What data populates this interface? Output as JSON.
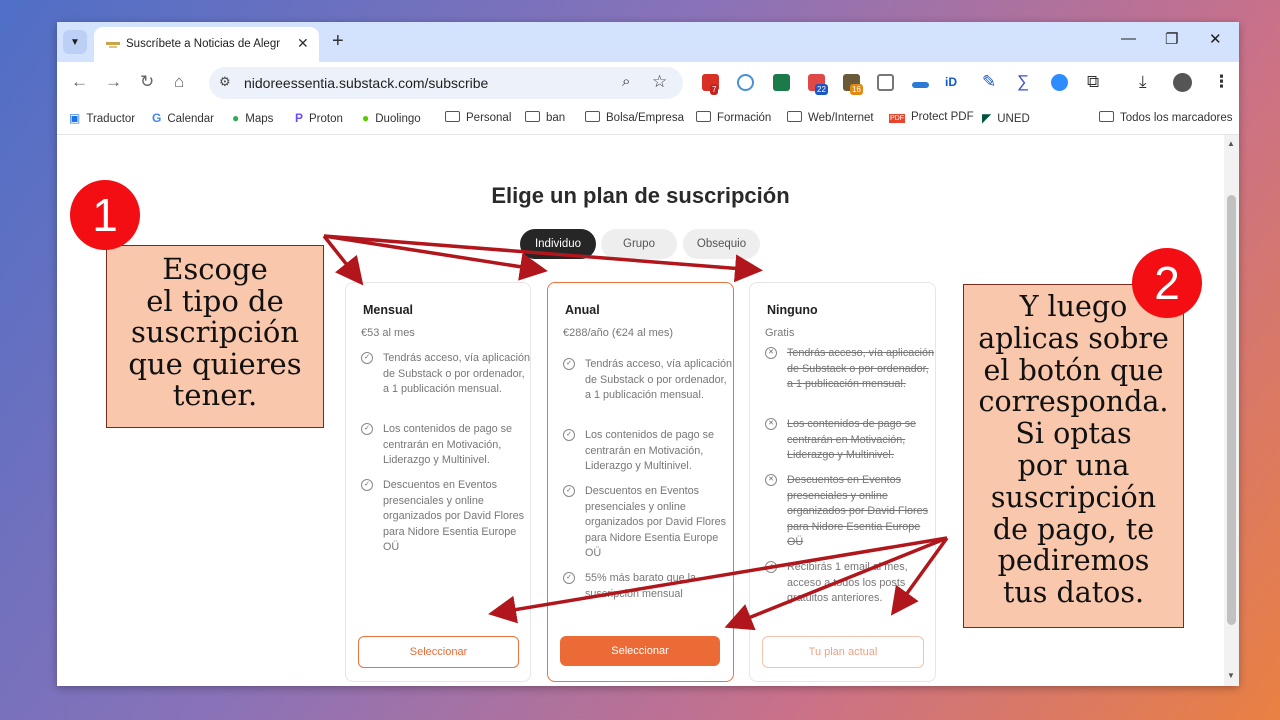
{
  "browser": {
    "tab_title": "Suscríbete a Noticias de Alegría y",
    "url": "nidoreessentia.substack.com/subscribe",
    "badges": [
      "7",
      "22",
      "16"
    ],
    "extension_label": "iD",
    "bookmarks": [
      "Traductor",
      "Calendar",
      "Maps",
      "Proton",
      "Duolingo",
      "Personal",
      "ban",
      "Bolsa/Empresa",
      "Formación",
      "Web/Internet",
      "Protect PDF",
      "UNED",
      "Todos los marcadores"
    ]
  },
  "page": {
    "heading": "Elige un plan de suscripción",
    "segments": [
      "Individuo",
      "Grupo",
      "Obsequio"
    ],
    "plans": [
      {
        "name": "Mensual",
        "price": "€53 al mes",
        "features": [
          "Tendrás acceso, vía aplicación de Substack o por ordenador, a 1 publicación mensual.",
          "Los contenidos de pago se centrarán en Motivación, Liderazgo y Multinivel.",
          "Descuentos en Eventos presenciales y online organizados por David Flores para Nidore Esentia Europe OÜ"
        ],
        "button": "Seleccionar"
      },
      {
        "name": "Anual",
        "price": "€288/año (€24 al mes)",
        "features": [
          "Tendrás acceso, vía aplicación de Substack o por ordenador, a 1 publicación mensual.",
          "Los contenidos de pago se centrarán en Motivación, Liderazgo y Multinivel.",
          "Descuentos en Eventos presenciales y online organizados por David Flores para Nidore Esentia Europe OÜ",
          "55% más barato que la suscripción mensual"
        ],
        "button": "Seleccionar"
      },
      {
        "name": "Ninguno",
        "price": "Gratis",
        "features": [
          "Tendrás acceso, vía aplicación de Substack o por ordenador, a 1 publicación mensual.",
          "Los contenidos de pago se centrarán en Motivación, Liderazgo y Multinivel.",
          "Descuentos en Eventos presenciales y online organizados por David Flores para Nidore Esentia Europe OÜ",
          "Recibirás 1 email al mes, acceso a todos los posts gratuitos anteriores."
        ],
        "button": "Tu plan actual"
      }
    ]
  },
  "annotations": {
    "step1": "1",
    "step2": "2",
    "callout1": [
      "Escoge",
      "el tipo de",
      "suscripción",
      "que quieres",
      "tener."
    ],
    "callout2": [
      "Y luego",
      "aplicas sobre",
      "el botón que",
      "corresponda.",
      "Si optas",
      "por una",
      "suscripción",
      "de pago, te",
      "pediremos",
      "tus datos."
    ],
    "arrow_color": "#b0161b"
  }
}
